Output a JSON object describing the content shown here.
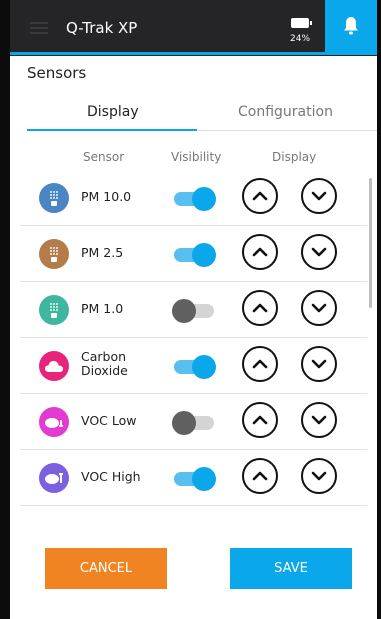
{
  "header": {
    "app_title": "Q-Trak XP",
    "battery_percent": "24%",
    "accent_color": "#0aa8ea"
  },
  "page": {
    "title": "Sensors"
  },
  "tabs": [
    {
      "label": "Display",
      "active": true
    },
    {
      "label": "Configuration",
      "active": false
    }
  ],
  "columns": {
    "sensor": "Sensor",
    "visibility": "Visibility",
    "display": "Display"
  },
  "sensors": [
    {
      "name": "PM 10.0",
      "icon": "particulate-icon",
      "color": "#4a86c4",
      "visible": true
    },
    {
      "name": "PM 2.5",
      "icon": "particulate-icon",
      "color": "#b47b4b",
      "visible": true
    },
    {
      "name": "PM 1.0",
      "icon": "particulate-icon",
      "color": "#3fb7a0",
      "visible": false
    },
    {
      "name": "Carbon Dioxide",
      "icon": "cloud-icon",
      "color": "#e8237a",
      "visible": true
    },
    {
      "name": "VOC Low",
      "icon": "voc-icon",
      "color": "#e23ad2",
      "visible": false
    },
    {
      "name": "VOC High",
      "icon": "voc-icon",
      "color": "#7c60e0",
      "visible": true
    }
  ],
  "buttons": {
    "cancel": "CANCEL",
    "save": "SAVE"
  }
}
